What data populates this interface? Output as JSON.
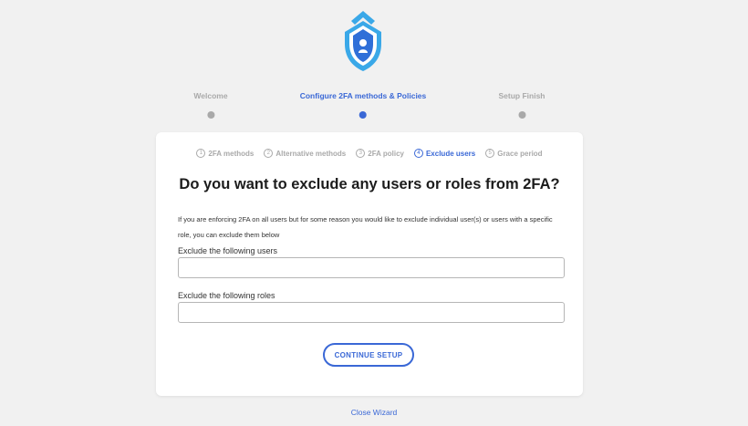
{
  "steps": [
    {
      "label": "Welcome",
      "active": false
    },
    {
      "label": "Configure 2FA methods & Policies",
      "active": true
    },
    {
      "label": "Setup Finish",
      "active": false
    }
  ],
  "subtabs": [
    {
      "num": "1",
      "label": "2FA methods",
      "active": false
    },
    {
      "num": "2",
      "label": "Alternative methods",
      "active": false
    },
    {
      "num": "3",
      "label": "2FA policy",
      "active": false
    },
    {
      "num": "4",
      "label": "Exclude users",
      "active": true
    },
    {
      "num": "5",
      "label": "Grace period",
      "active": false
    }
  ],
  "heading": "Do you want to exclude any users or roles from 2FA?",
  "description": "If you are enforcing 2FA on all users but for some reason you would like to exclude individual user(s) or users with a specific role, you can exclude them below",
  "fields": {
    "users_label": "Exclude the following users",
    "users_value": "",
    "roles_label": "Exclude the following roles",
    "roles_value": ""
  },
  "continue_label": "CONTINUE SETUP",
  "close_label": "Close Wizard",
  "colors": {
    "accent": "#3a68d6",
    "inactive": "#a9a9a9",
    "background": "#f1f1f1"
  },
  "icons": {
    "logo": "shield-lock-icon"
  }
}
